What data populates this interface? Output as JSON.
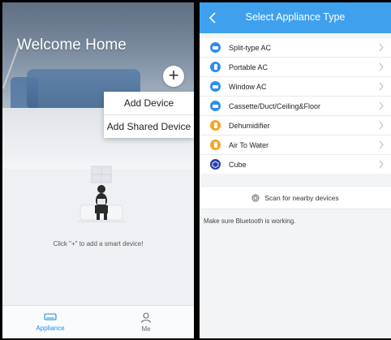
{
  "home_screen": {
    "title": "Welcome Home",
    "add_button_glyph": "+",
    "menu": {
      "items": [
        {
          "label": "Add Device"
        },
        {
          "label": "Add Shared Device"
        }
      ]
    },
    "empty_state_text": "Click \"+\" to add a smart device!",
    "tabbar": {
      "tabs": [
        {
          "label": "Appliance",
          "icon": "ac-unit-icon",
          "active": true
        },
        {
          "label": "Me",
          "icon": "person-icon",
          "active": false
        }
      ]
    }
  },
  "select_screen": {
    "title": "Select Appliance Type",
    "back_icon": "chevron-left-icon",
    "appliances": [
      {
        "label": "Split-type AC",
        "icon": "split-ac-icon",
        "color": "#2f8cf0"
      },
      {
        "label": "Portable AC",
        "icon": "portable-ac-icon",
        "color": "#2f8cf0"
      },
      {
        "label": "Window AC",
        "icon": "window-ac-icon",
        "color": "#2f8cf0"
      },
      {
        "label": "Cassette/Duct/Ceiling&Floor",
        "icon": "cassette-ac-icon",
        "color": "#2f8cf0"
      },
      {
        "label": "Dehumidifier",
        "icon": "dehumidifier-icon",
        "color": "#f5a623"
      },
      {
        "label": "Air To Water",
        "icon": "air-to-water-icon",
        "color": "#f5a623"
      },
      {
        "label": "Cube",
        "icon": "cube-icon",
        "color": "#2b3fa8"
      }
    ],
    "scan_label": "Scan for nearby devices",
    "hint": "Make sure Bluetooth is working."
  },
  "colors": {
    "accent_blue": "#3fa1ee",
    "tab_active": "#1e88e5",
    "orange": "#f5a623"
  }
}
